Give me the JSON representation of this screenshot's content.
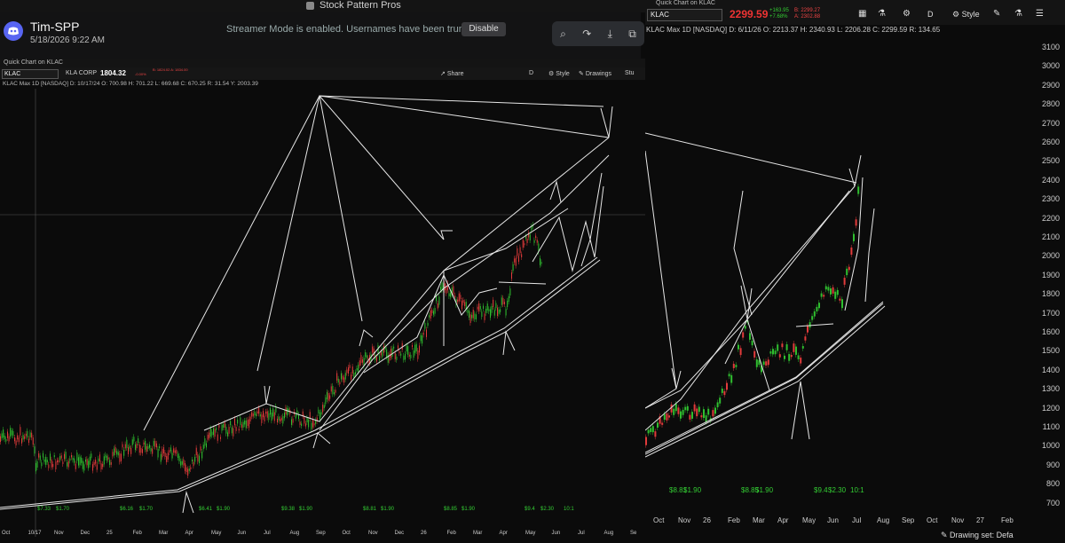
{
  "app": {
    "title": "Stock Pattern Pros"
  },
  "discord": {
    "poster": "Tim-SPP",
    "timestamp": "5/18/2026 9:22 AM",
    "streamer_message": "Streamer Mode is enabled. Usernames have been truncated.",
    "disable_label": "Disable"
  },
  "left_chart": {
    "panel_title": "Quick Chart on KLAC",
    "symbol": "KLAC",
    "company": "KLA CORP",
    "price": "1804.32",
    "change": "-0.00%",
    "bid_ask": "B: 1824.02 A: 1834.00",
    "toolbar": {
      "share": "Share",
      "period": "D",
      "style": "Style",
      "drawings": "Drawings",
      "studies": "Stu"
    },
    "ohlc_line": "KLAC Max 1D [NASDAQ]  D: 10/17/24  O: 700.98  H: 701.22  L: 669.68  C: 670.25  R: 31.54  Y: 2003.39",
    "x_labels": [
      "Oct",
      "10/17",
      "Nov",
      "Dec",
      "25",
      "Feb",
      "Mar",
      "Apr",
      "May",
      "Jun",
      "Jul",
      "Aug",
      "Sep",
      "Oct",
      "Nov",
      "Dec",
      "26",
      "Feb",
      "Mar",
      "Apr",
      "May",
      "Jun",
      "Jul",
      "Aug",
      "Se"
    ],
    "dividends": [
      "$7.33",
      "$1.70",
      "$6.16",
      "$1.70",
      "$6.41",
      "$1.90",
      "$9.38",
      "$1.90",
      "$8.81",
      "$1.90",
      "$8.85",
      "$1.90",
      "$9.4",
      "$2.30",
      "10:1"
    ]
  },
  "right_chart": {
    "panel_title": "Quick Chart on KLAC",
    "symbol": "KLAC",
    "price": "2299.59",
    "change": "+163.95",
    "change_pct": "+7.68%",
    "bid": "B: 2299.27",
    "ask": "A: 2302.88",
    "toolbar": {
      "period": "D",
      "style": "Style"
    },
    "ohlc_line": "KLAC Max 1D [NASDAQ]  D: 6/11/26  O: 2213.37  H: 2340.93  L: 2206.28  C: 2299.59  R: 134.65",
    "y_labels": [
      "3100",
      "3000",
      "2900",
      "2800",
      "2700",
      "2600",
      "2500",
      "2400",
      "2300",
      "2200",
      "2100",
      "2000",
      "1900",
      "1800",
      "1700",
      "1600",
      "1500",
      "1400",
      "1300",
      "1200",
      "1100",
      "1000",
      "900",
      "800",
      "700"
    ],
    "x_labels": [
      "Oct",
      "Nov",
      "26",
      "Feb",
      "Mar",
      "Apr",
      "May",
      "Jun",
      "Jul",
      "Aug",
      "Sep",
      "Oct",
      "Nov",
      "27",
      "Feb"
    ],
    "dividends": [
      "$8.81",
      "$1.90",
      "$8.85",
      "$1.90",
      "$9.4",
      "$2.30",
      "10:1"
    ],
    "status": "Drawing set: Defa"
  },
  "colors": {
    "bull": "#2fbf2f",
    "bear": "#e23b3b",
    "drawing": "#e0e0e0",
    "bg": "#0b0b0b"
  }
}
